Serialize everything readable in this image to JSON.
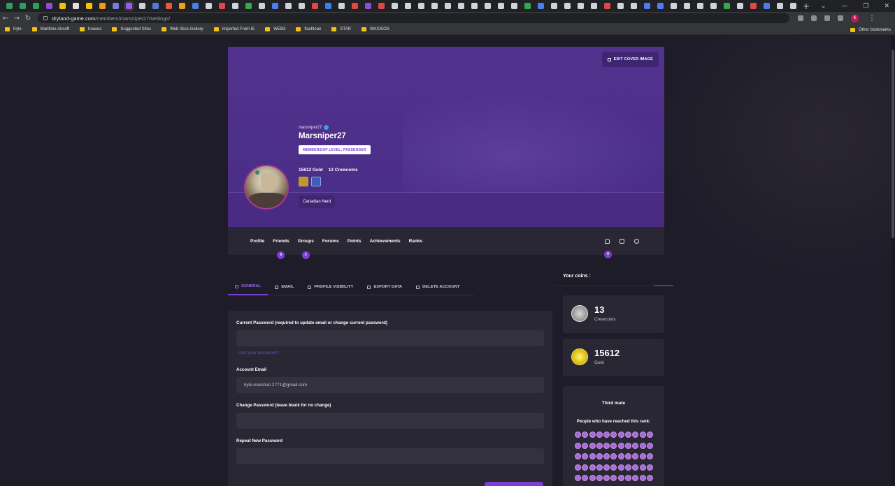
{
  "browser": {
    "tab_favicon_colors": [
      "#2e9e5b",
      "#2e9e5b",
      "#2e9e5b",
      "#8a4fd6",
      "#f4c20d",
      "#e0e0e0",
      "#f4c20d",
      "#f29a1c",
      "#7a7de0",
      "#9b59f5",
      "#cfd3da",
      "#5578d8",
      "#e55a3c",
      "#f0a020",
      "#4e7ce8",
      "#cfd3da",
      "#e04848",
      "#cfd3da",
      "#33a852",
      "#cfd3da",
      "#4e7ce8",
      "#cfd3da",
      "#cfd3da",
      "#e04848",
      "#3b7ff0",
      "#cfd3da",
      "#e04848",
      "#8a4fd6",
      "#e04848",
      "#cfd3da",
      "#cfd3da",
      "#cfd3da",
      "#cfd3da",
      "#cfd3da",
      "#cfd3da",
      "#cfd3da",
      "#cfd3da",
      "#cfd3da",
      "#cfd3da",
      "#33a852",
      "#4e7ce8",
      "#cfd3da",
      "#cfd3da",
      "#cfd3da",
      "#cfd3da",
      "#e04848",
      "#cfd3da",
      "#cfd3da",
      "#4e7ce8",
      "#4e7ce8",
      "#cfd3da",
      "#cfd3da",
      "#cfd3da",
      "#cfd3da",
      "#33a852",
      "#cfd3da",
      "#e04848",
      "#4e7ce8",
      "#cfd3da",
      "#cfd3da"
    ],
    "url_host": "dryland-game.com",
    "url_path": "/members/marsniper27/settings/",
    "profile_initial": "K",
    "bookmarks": [
      "Kyle",
      "Maritime Airsoft",
      "houses",
      "Suggested Sites",
      "Web Slice Gallery",
      "Imported From IE",
      "WEB3",
      "flashloan",
      "STAR",
      "WAX/EOS"
    ],
    "other_bookmarks": "Other bookmarks"
  },
  "cover": {
    "edit_label": "EDIT COVER IMAGE"
  },
  "profile": {
    "username": "marsniper27",
    "display_name": "Marsniper27",
    "membership": "MEMBERSHIP LEVEL: PASSENGER",
    "gold_text": "15612 Gold",
    "crewcoins_text": "13 Crewcoins",
    "bio": "Canadian Nerd"
  },
  "profile_nav": {
    "items": [
      {
        "label": "Profile",
        "count": ""
      },
      {
        "label": "Friends",
        "count": "6"
      },
      {
        "label": "Groups",
        "count": "2"
      },
      {
        "label": "Forums",
        "count": ""
      },
      {
        "label": "Points",
        "count": ""
      },
      {
        "label": "Achievements",
        "count": ""
      },
      {
        "label": "Ranks",
        "count": ""
      }
    ],
    "notifications_count": "0"
  },
  "settings_tabs": [
    "GENERAL",
    "EMAIL",
    "PROFILE VISIBILITY",
    "EXPORT DATA",
    "DELETE ACCOUNT"
  ],
  "form": {
    "current_password_label": "Current Password (required to update email or change current password)",
    "current_password_value": "",
    "lost_password": "Lost your password?",
    "email_label": "Account Email",
    "email_value": "kyle.marshall.2771@gmail.com",
    "change_password_label": "Change Password (leave blank for no change)",
    "change_password_value": "",
    "repeat_password_label": "Repeat New Password",
    "repeat_password_value": ""
  },
  "sidebar": {
    "coins_title": "Your coins :",
    "crewcoins_value": "13",
    "crewcoins_label": "Crewcoins",
    "gold_value": "15612",
    "gold_label": "Gold",
    "rank_title": "Third mate",
    "rank_subtitle": "People who have reached this rank:",
    "rank_member_count": 55
  },
  "colors": {
    "accent": "#7c3fd1",
    "cover": "#4c2f88",
    "card": "#292734",
    "page": "#1e1c28"
  }
}
